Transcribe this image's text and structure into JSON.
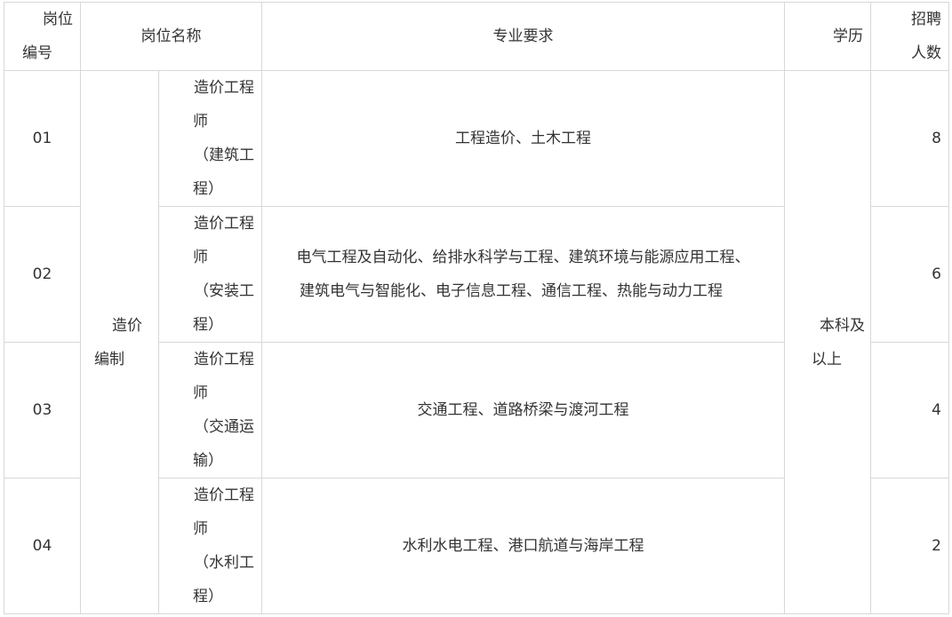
{
  "table": {
    "headers": {
      "id_line1": "岗位",
      "id_line2": "编号",
      "position_name": "岗位名称",
      "major": "专业要求",
      "education": "学历",
      "count_line1": "招聘",
      "count_line2": "人数"
    },
    "category": {
      "line1": "造价",
      "line2": "编制"
    },
    "education": {
      "line1": "本科及",
      "line2": "以上"
    },
    "rows": [
      {
        "id": "01",
        "title_lines": [
          "造价工程",
          "师",
          "（建筑工",
          "程）"
        ],
        "major_lines": [
          "工程造价、土木工程"
        ],
        "count": "8"
      },
      {
        "id": "02",
        "title_lines": [
          "造价工程",
          "师",
          "（安装工",
          "程）"
        ],
        "major_lines": [
          "电气工程及自动化、给排水科学与工程、建筑环境与能源应用工程、",
          "建筑电气与智能化、电子信息工程、通信工程、热能与动力工程"
        ],
        "count": "6"
      },
      {
        "id": "03",
        "title_lines": [
          "造价工程",
          "师",
          "（交通运",
          "输）"
        ],
        "major_lines": [
          "交通工程、道路桥梁与渡河工程"
        ],
        "count": "4"
      },
      {
        "id": "04",
        "title_lines": [
          "造价工程",
          "师",
          "（水利工",
          "程）"
        ],
        "major_lines": [
          "水利水电工程、港口航道与海岸工程"
        ],
        "count": "2"
      }
    ]
  }
}
